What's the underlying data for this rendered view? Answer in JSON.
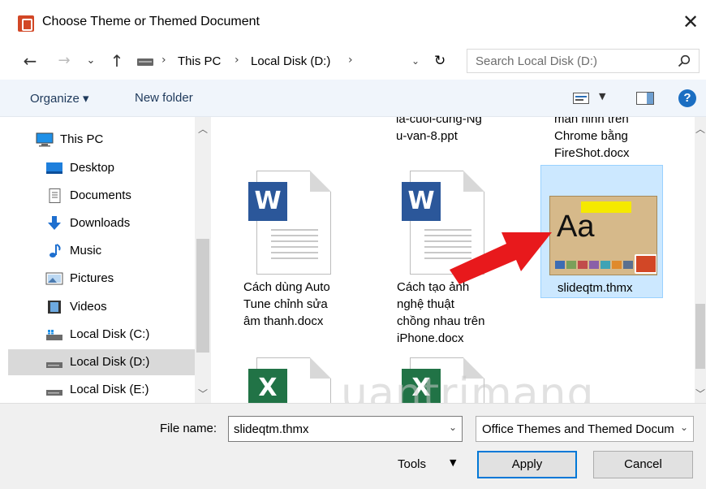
{
  "window": {
    "title": "Choose Theme or Themed Document"
  },
  "nav": {
    "back": "←",
    "forward": "→",
    "recent": "⌄",
    "up": "↑",
    "breadcrumb": [
      "This PC",
      "Local Disk (D:)"
    ],
    "refresh": "↻",
    "search_placeholder": "Search Local Disk (D:)"
  },
  "toolbar": {
    "organize_label": "Organize ▾",
    "new_folder_label": "New folder",
    "help": "?"
  },
  "sidebar": {
    "items": [
      {
        "label": "This PC",
        "icon": "pc-icon"
      },
      {
        "label": "Desktop",
        "icon": "desktop-icon"
      },
      {
        "label": "Documents",
        "icon": "documents-icon"
      },
      {
        "label": "Downloads",
        "icon": "downloads-icon"
      },
      {
        "label": "Music",
        "icon": "music-icon"
      },
      {
        "label": "Pictures",
        "icon": "pictures-icon"
      },
      {
        "label": "Videos",
        "icon": "videos-icon"
      },
      {
        "label": "Local Disk (C:)",
        "icon": "drive-icon"
      },
      {
        "label": "Local Disk (D:)",
        "icon": "drive-icon",
        "selected": true
      },
      {
        "label": "Local Disk (E:)",
        "icon": "drive-icon"
      }
    ]
  },
  "files": [
    {
      "name_lines": [
        "la-cuoi-cung-Ng",
        "u-van-8.ppt"
      ]
    },
    {
      "name_lines": [
        "man hinh tren",
        "Chrome bằng",
        "FireShot.docx"
      ]
    },
    {
      "name_lines": [
        "Cách dùng Auto",
        "Tune chỉnh sửa",
        "âm thanh.docx"
      ],
      "type": "W"
    },
    {
      "name_lines": [
        "Cách tạo ảnh",
        "nghệ thuật",
        "chồng nhau trên",
        "iPhone.docx"
      ],
      "type": "W"
    },
    {
      "name_lines": [
        "slideqtm.thmx"
      ],
      "selected": true,
      "thumb_text": "Aa"
    },
    {
      "type": "X"
    },
    {
      "type": "X"
    }
  ],
  "watermark": "uantrimang",
  "footer": {
    "file_name_label": "File name:",
    "file_name_value": "slideqtm.thmx",
    "file_type_value": "Office Themes and Themed Documents",
    "tools_label": "Tools",
    "apply_label": "Apply",
    "cancel_label": "Cancel"
  },
  "colors": {
    "accent": "#0078d7",
    "selection": "#cce8ff",
    "arrow": "#e8191c",
    "word": "#2b579a",
    "excel": "#217346"
  }
}
